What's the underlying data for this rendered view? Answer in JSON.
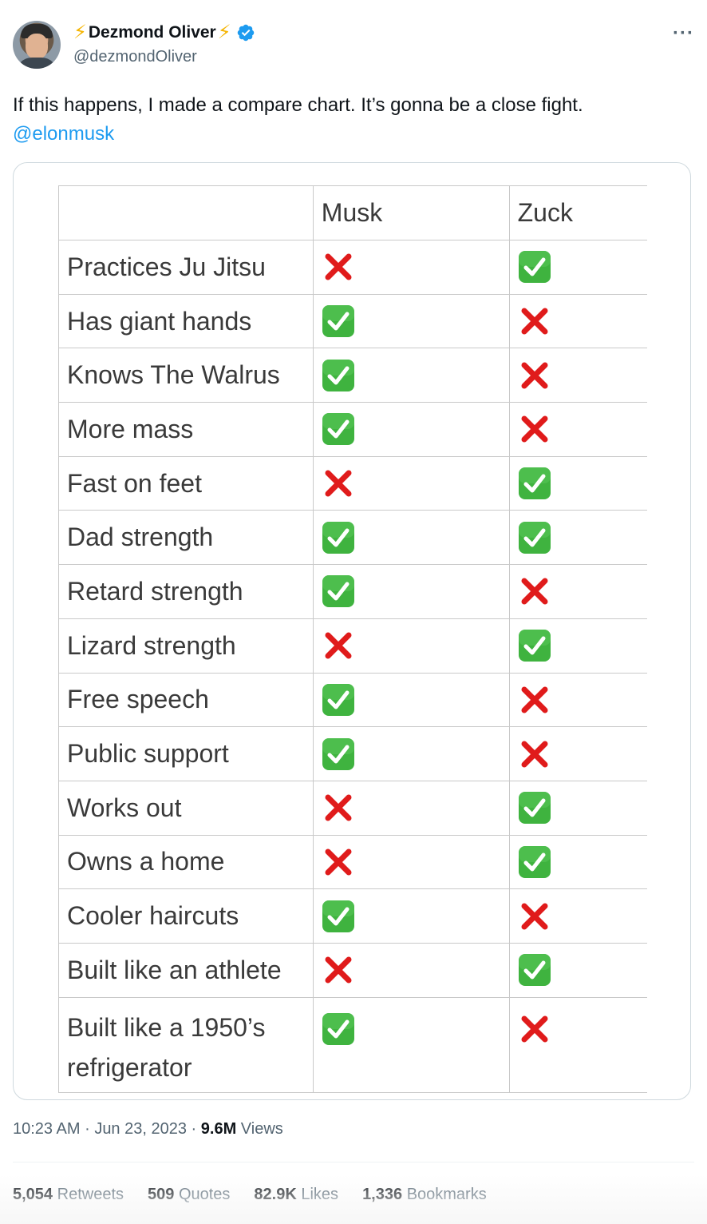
{
  "author": {
    "display_name": "Dezmond Oliver",
    "handle": "@dezmondOliver",
    "name_emoji": "⚡"
  },
  "tweet": {
    "text": "If this happens, I made a compare chart. It’s gonna be a close fight.",
    "mention": "@elonmusk"
  },
  "table": {
    "headers": [
      "",
      "Musk",
      "Zuck"
    ],
    "rows": [
      {
        "label": "Practices Ju Jitsu",
        "musk": "cross",
        "zuck": "check"
      },
      {
        "label": "Has giant hands",
        "musk": "check",
        "zuck": "cross"
      },
      {
        "label": "Knows The Walrus",
        "musk": "check",
        "zuck": "cross"
      },
      {
        "label": "More mass",
        "musk": "check",
        "zuck": "cross"
      },
      {
        "label": "Fast on feet",
        "musk": "cross",
        "zuck": "check"
      },
      {
        "label": "Dad strength",
        "musk": "check",
        "zuck": "check"
      },
      {
        "label": "Retard strength",
        "musk": "check",
        "zuck": "cross"
      },
      {
        "label": "Lizard strength",
        "musk": "cross",
        "zuck": "check"
      },
      {
        "label": "Free speech",
        "musk": "check",
        "zuck": "cross"
      },
      {
        "label": "Public support",
        "musk": "check",
        "zuck": "cross"
      },
      {
        "label": "Works out",
        "musk": "cross",
        "zuck": "check"
      },
      {
        "label": "Owns a home",
        "musk": "cross",
        "zuck": "check"
      },
      {
        "label": "Cooler haircuts",
        "musk": "check",
        "zuck": "cross"
      },
      {
        "label": "Built like an athlete",
        "musk": "cross",
        "zuck": "check"
      },
      {
        "label": "Built like a 1950’s refrigerator",
        "musk": "check",
        "zuck": "cross"
      }
    ]
  },
  "meta": {
    "time": "10:23 AM",
    "separator": "·",
    "date": "Jun 23, 2023",
    "views_count": "9.6M",
    "views_label": "Views"
  },
  "stats": {
    "retweets_count": "5,054",
    "retweets_label": "Retweets",
    "quotes_count": "509",
    "quotes_label": "Quotes",
    "likes_count": "82.9K",
    "likes_label": "Likes",
    "bookmarks_count": "1,336",
    "bookmarks_label": "Bookmarks"
  },
  "colors": {
    "link": "#1d9bf0",
    "check_bg": "#3fb33f",
    "cross": "#e01b1b",
    "muted": "#536471"
  },
  "icons": {
    "verified": "verified-badge-icon",
    "more": "more-options-icon",
    "check": "check-mark-icon",
    "cross": "cross-mark-icon"
  }
}
